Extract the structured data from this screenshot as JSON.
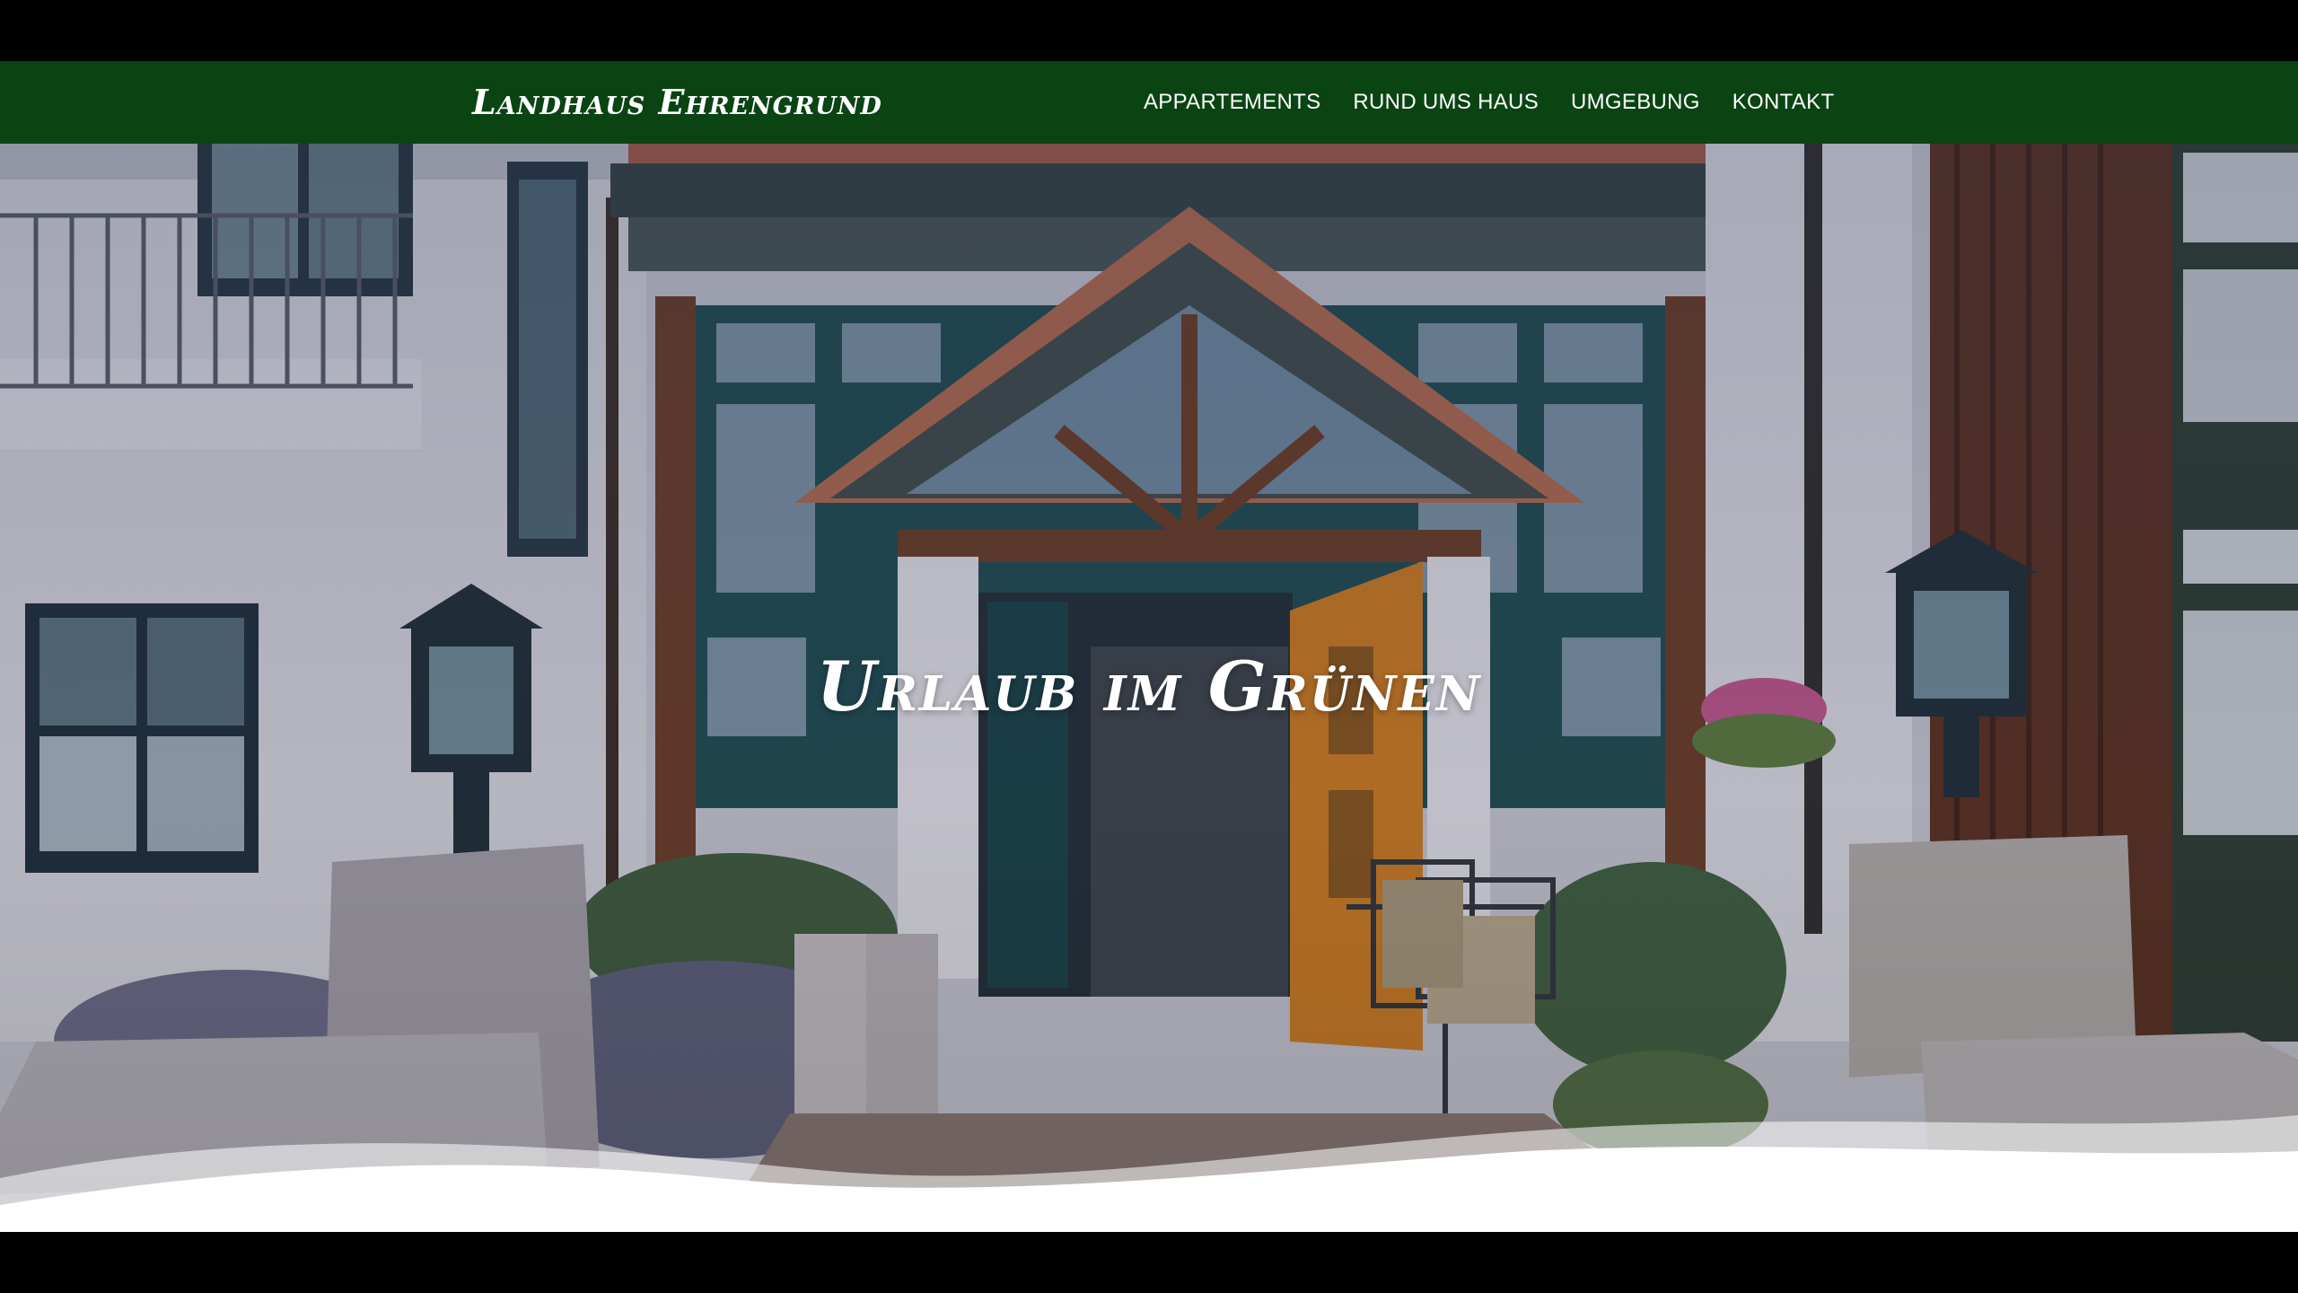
{
  "site": {
    "logo_text": "Landhaus Ehrengrund"
  },
  "nav": {
    "items": [
      {
        "label": "APPARTEMENTS"
      },
      {
        "label": "RUND UMS HAUS"
      },
      {
        "label": "UMGEBUNG"
      },
      {
        "label": "KONTAKT"
      }
    ]
  },
  "hero": {
    "headline": "Urlaub im Grünen"
  },
  "colors": {
    "navbar_bg": "#0a4413",
    "nav_text": "#ffffff",
    "page_frame": "#000000"
  }
}
